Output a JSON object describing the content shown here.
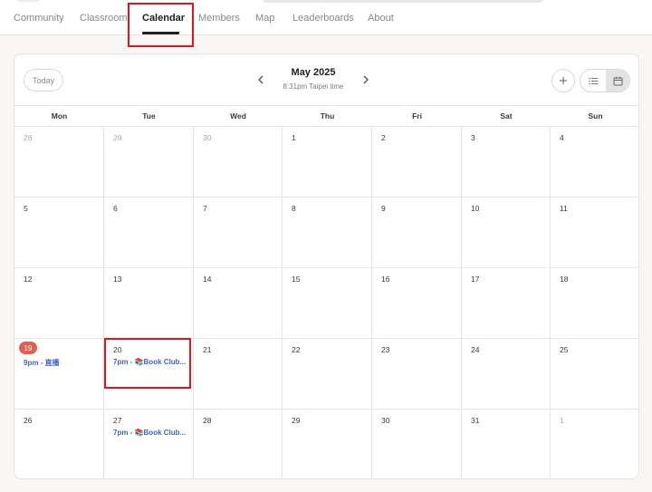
{
  "nav": {
    "tabs": [
      {
        "label": "Community",
        "active": false
      },
      {
        "label": "Classroom",
        "active": false
      },
      {
        "label": "Calendar",
        "active": true
      },
      {
        "label": "Members",
        "active": false
      },
      {
        "label": "Map",
        "active": false
      },
      {
        "label": "Leaderboards",
        "active": false
      },
      {
        "label": "About",
        "active": false
      }
    ]
  },
  "calendar": {
    "today_label": "Today",
    "month_title": "May 2025",
    "timezone_text": "8:31pm Taipei time",
    "icons": {
      "prev": "chevron-left-icon",
      "next": "chevron-right-icon",
      "add": "plus-icon",
      "list_view": "list-icon",
      "calendar_view": "calendar-icon",
      "event_book": "books-icon"
    },
    "weekdays": [
      "Mon",
      "Tue",
      "Wed",
      "Thu",
      "Fri",
      "Sat",
      "Sun"
    ],
    "weeks": [
      [
        {
          "day": "28",
          "muted": true
        },
        {
          "day": "29",
          "muted": true
        },
        {
          "day": "30",
          "muted": true
        },
        {
          "day": "1"
        },
        {
          "day": "2"
        },
        {
          "day": "3"
        },
        {
          "day": "4"
        }
      ],
      [
        {
          "day": "5"
        },
        {
          "day": "6"
        },
        {
          "day": "7"
        },
        {
          "day": "8"
        },
        {
          "day": "9"
        },
        {
          "day": "10"
        },
        {
          "day": "11"
        }
      ],
      [
        {
          "day": "12"
        },
        {
          "day": "13"
        },
        {
          "day": "14"
        },
        {
          "day": "15"
        },
        {
          "day": "16"
        },
        {
          "day": "17"
        },
        {
          "day": "18"
        }
      ],
      [
        {
          "day": "19",
          "today": true,
          "event": {
            "time": "9pm",
            "title": "直播"
          }
        },
        {
          "day": "20",
          "event": {
            "time": "7pm",
            "title": "Book Club...",
            "icon": "📚"
          }
        },
        {
          "day": "21"
        },
        {
          "day": "22"
        },
        {
          "day": "23"
        },
        {
          "day": "24"
        },
        {
          "day": "25"
        }
      ],
      [
        {
          "day": "26"
        },
        {
          "day": "27",
          "event": {
            "time": "7pm",
            "title": "Book Club...",
            "icon": "📚"
          }
        },
        {
          "day": "28"
        },
        {
          "day": "29"
        },
        {
          "day": "30"
        },
        {
          "day": "31"
        },
        {
          "day": "1",
          "muted": true
        }
      ]
    ],
    "colors": {
      "today_badge": "#e15f4f",
      "event_text": "#3f63c9",
      "highlight": "#e0161c"
    }
  }
}
